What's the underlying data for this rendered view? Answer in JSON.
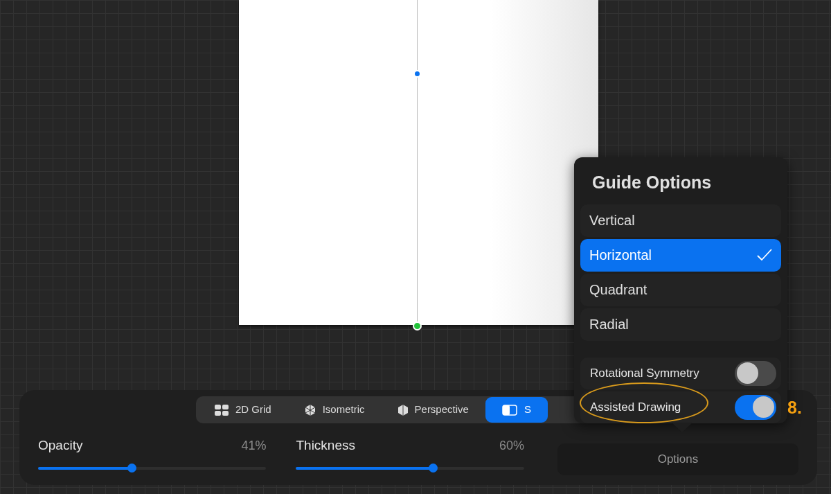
{
  "guide_tabs": [
    {
      "label": "2D Grid",
      "kind": "grid",
      "selected": false
    },
    {
      "label": "Isometric",
      "kind": "isometric",
      "selected": false
    },
    {
      "label": "Perspective",
      "kind": "perspective",
      "selected": false
    },
    {
      "label": "S",
      "kind": "symmetry",
      "selected": true
    }
  ],
  "sliders": [
    {
      "label": "Opacity",
      "reading": "41%",
      "level": 0.41
    },
    {
      "label": "Thickness",
      "reading": "60%",
      "level": 0.6
    }
  ],
  "options_button": "Options",
  "popover": {
    "title": "Guide Options",
    "choices": [
      {
        "label": "Vertical",
        "selected": false
      },
      {
        "label": "Horizontal",
        "selected": true
      },
      {
        "label": "Quadrant",
        "selected": false
      },
      {
        "label": "Radial",
        "selected": false
      }
    ],
    "toggles": [
      {
        "label": "Rotational Symmetry",
        "on": false,
        "highlighted": false
      },
      {
        "label": "Assisted Drawing",
        "on": true,
        "highlighted": true
      }
    ]
  },
  "annotation": "8."
}
